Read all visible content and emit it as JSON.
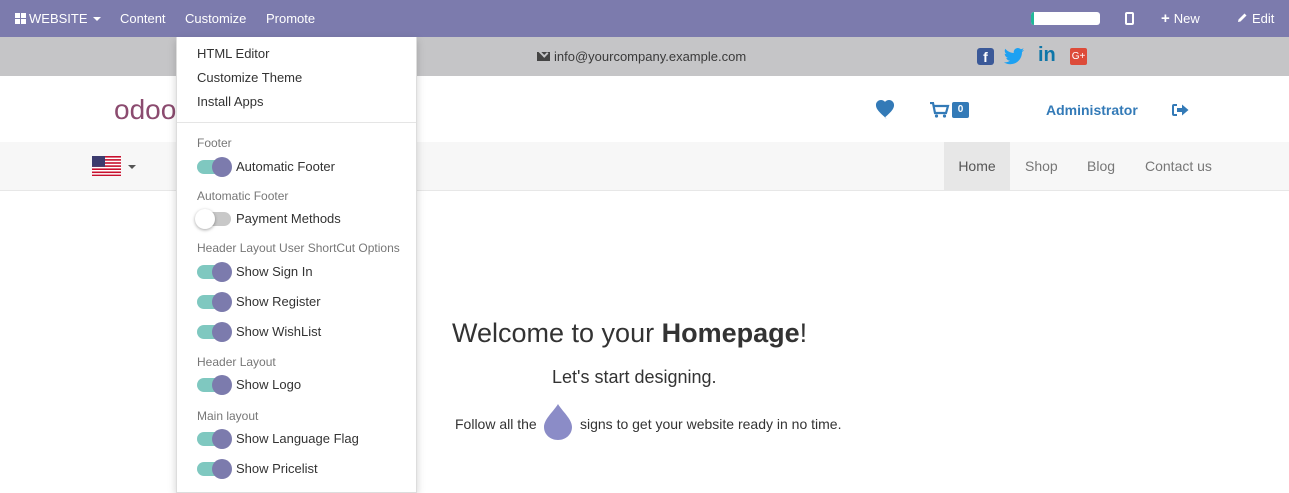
{
  "topbar": {
    "app_label": "WEBSITE",
    "menu": [
      "Content",
      "Customize",
      "Promote"
    ],
    "progress_fraction": 0.04,
    "new_label": "New",
    "edit_label": "Edit"
  },
  "contact": {
    "email": "info@yourcompany.example.com",
    "social": [
      "facebook-icon",
      "twitter-icon",
      "linkedin-icon",
      "google-plus-icon"
    ],
    "linkedin_text": "in",
    "facebook_text": "f",
    "gplus_text": "G+"
  },
  "header": {
    "logo_text": "odoo",
    "cart_count": "0",
    "user": "Administrator"
  },
  "nav": {
    "items": [
      "Home",
      "Shop",
      "Blog",
      "Contact us"
    ],
    "active": "Home"
  },
  "hero": {
    "title_prefix": "Welcome to your ",
    "title_bold": "Homepage",
    "title_suffix": "!",
    "subtitle": "Let's start designing.",
    "follow_before": "Follow all the",
    "follow_after": "signs to get your website ready in no time."
  },
  "dropdown": {
    "links": [
      "HTML Editor",
      "Customize Theme",
      "Install Apps"
    ],
    "sections": [
      {
        "header": "Footer",
        "toggles": [
          {
            "label": "Automatic Footer",
            "on": true
          }
        ]
      },
      {
        "header": "Automatic Footer",
        "toggles": [
          {
            "label": "Payment Methods",
            "on": false
          }
        ]
      },
      {
        "header": "Header Layout User ShortCut Options",
        "toggles": [
          {
            "label": "Show Sign In",
            "on": true
          },
          {
            "label": "Show Register",
            "on": true
          },
          {
            "label": "Show WishList",
            "on": true
          }
        ]
      },
      {
        "header": "Header Layout",
        "toggles": [
          {
            "label": "Show Logo",
            "on": true
          }
        ]
      },
      {
        "header": "Main layout",
        "toggles": [
          {
            "label": "Show Language Flag",
            "on": true
          },
          {
            "label": "Show Pricelist",
            "on": true
          }
        ]
      }
    ]
  },
  "colors": {
    "topbar": "#7c7bad",
    "toggle_track_on": "#7fc8c0",
    "toggle_knob_on": "#7c7bad",
    "link_blue": "#337ab7"
  }
}
